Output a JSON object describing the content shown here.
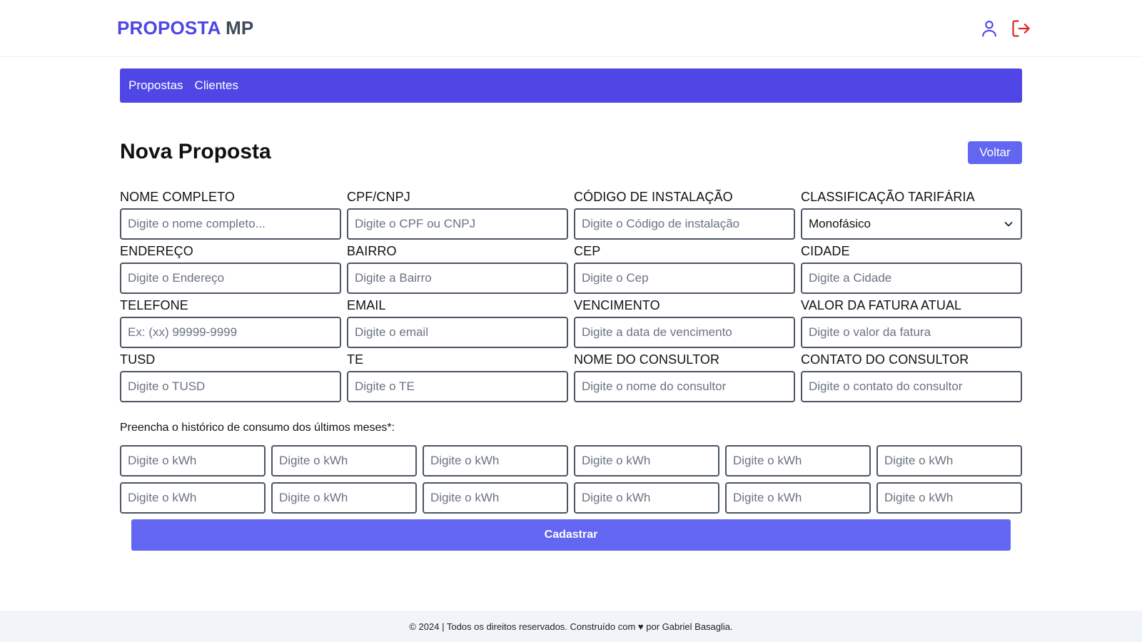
{
  "header": {
    "logo_part1": "PROPOSTA",
    "logo_part2": "MP",
    "icons": [
      "user-icon",
      "logout-icon"
    ]
  },
  "nav": {
    "items": [
      {
        "label": "Propostas"
      },
      {
        "label": "Clientes"
      }
    ]
  },
  "page": {
    "title": "Nova Proposta",
    "back_label": "Voltar"
  },
  "form": {
    "fields": [
      {
        "label": "NOME COMPLETO",
        "placeholder": "Digite o nome completo..."
      },
      {
        "label": "CPF/CNPJ",
        "placeholder": "Digite o CPF ou CNPJ"
      },
      {
        "label": "CÓDIGO DE INSTALAÇÃO",
        "placeholder": "Digite o Código de instalação"
      },
      {
        "label": "CLASSIFICAÇÃO TARIFÁRIA",
        "value": "Monofásico"
      },
      {
        "label": "ENDEREÇO",
        "placeholder": "Digite o Endereço"
      },
      {
        "label": "BAIRRO",
        "placeholder": "Digite a Bairro"
      },
      {
        "label": "CEP",
        "placeholder": "Digite o Cep"
      },
      {
        "label": "CIDADE",
        "placeholder": "Digite a Cidade"
      },
      {
        "label": "TELEFONE",
        "placeholder": "Ex: (xx) 99999-9999"
      },
      {
        "label": "EMAIL",
        "placeholder": "Digite o email"
      },
      {
        "label": "VENCIMENTO",
        "placeholder": "Digite a data de vencimento"
      },
      {
        "label": "VALOR DA FATURA ATUAL",
        "placeholder": "Digite o valor da fatura"
      },
      {
        "label": "TUSD",
        "placeholder": "Digite o TUSD"
      },
      {
        "label": "TE",
        "placeholder": "Digite o TE"
      },
      {
        "label": "NOME DO CONSULTOR",
        "placeholder": "Digite o nome do consultor"
      },
      {
        "label": "CONTATO DO CONSULTOR",
        "placeholder": "Digite o contato do consultor"
      }
    ],
    "history_label": "Preencha o histórico de consumo dos últimos meses*:",
    "kwh_placeholder": "Digite o kWh",
    "submit_label": "Cadastrar"
  },
  "footer": {
    "text": "© 2024 | Todos os direitos reservados. Construído com ♥ por Gabriel Basaglia."
  },
  "colors": {
    "primary": "#4f46e5",
    "button": "#6366f1",
    "logout": "#dc2626"
  }
}
